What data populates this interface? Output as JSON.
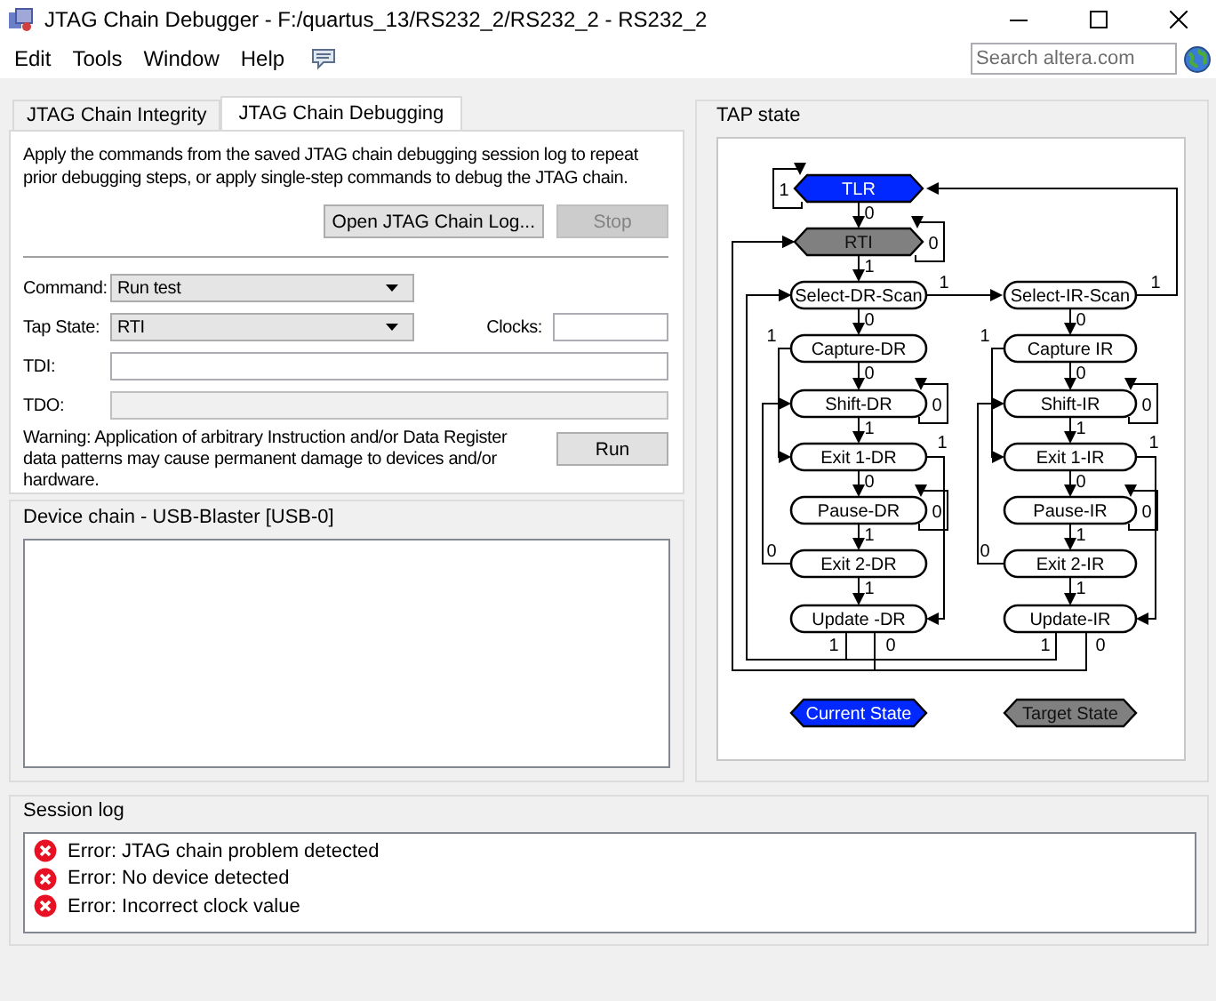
{
  "window": {
    "title": "JTAG Chain Debugger - F:/quartus_13/RS232_2/RS232_2 - RS232_2"
  },
  "menu": [
    "Edit",
    "Tools",
    "Window",
    "Help"
  ],
  "search": {
    "placeholder": "Search altera.com"
  },
  "tabs": [
    {
      "label": "JTAG Chain Integrity",
      "selected": false
    },
    {
      "label": "JTAG Chain Debugging",
      "selected": true
    }
  ],
  "debugging": {
    "description": "Apply the commands from the saved JTAG chain debugging session log to repeat prior debugging steps, or apply single-step commands to debug the JTAG chain.",
    "buttons": [
      {
        "label": "Open JTAG Chain Log...",
        "disabled": false
      },
      {
        "label": "Stop",
        "disabled": true
      }
    ],
    "command": {
      "label": "Command:",
      "value": "Run test"
    },
    "tap_state": {
      "label": "Tap State:",
      "value": "RTI"
    },
    "clocks": {
      "label": "Clocks:"
    },
    "tdi": {
      "label": "TDI:",
      "disabled": false
    },
    "tdo": {
      "label": "TDO:",
      "disabled": true
    },
    "warning": "Warning: Application of arbitrary Instruction and/or Data Register data patterns may cause permanent damage to devices and/or hardware.",
    "run_button": "Run"
  },
  "device_chain": {
    "title": "Device chain - USB-Blaster [USB-0]"
  },
  "tap_state": {
    "title": "TAP state",
    "nodes": [
      {
        "label": "TLR",
        "current": true,
        "target": false
      },
      {
        "label": "RTI",
        "current": false,
        "target": true
      },
      {
        "label": "Select-DR-Scan",
        "current": false,
        "target": false
      },
      {
        "label": "Capture-DR",
        "current": false,
        "target": false
      },
      {
        "label": "Shift-DR",
        "current": false,
        "target": false
      },
      {
        "label": "Exit 1-DR",
        "current": false,
        "target": false
      },
      {
        "label": "Pause-DR",
        "current": false,
        "target": false
      },
      {
        "label": "Exit 2-DR",
        "current": false,
        "target": false
      },
      {
        "label": "Update -DR",
        "current": false,
        "target": false
      },
      {
        "label": "Select-IR-Scan",
        "current": false,
        "target": false
      },
      {
        "label": "Capture IR",
        "current": false,
        "target": false
      },
      {
        "label": "Shift-IR",
        "current": false,
        "target": false
      },
      {
        "label": "Exit 1-IR",
        "current": false,
        "target": false
      },
      {
        "label": "Pause-IR",
        "current": false,
        "target": false
      },
      {
        "label": "Exit 2-IR",
        "current": false,
        "target": false
      },
      {
        "label": "Update-IR",
        "current": false,
        "target": false
      }
    ],
    "transitions": [
      {
        "label": "0"
      },
      {
        "label": "1"
      },
      {
        "label": "0"
      },
      {
        "label": "1"
      },
      {
        "label": "1"
      },
      {
        "label": "1"
      },
      {
        "label": "0"
      },
      {
        "label": "1"
      },
      {
        "label": "0"
      },
      {
        "label": "0"
      },
      {
        "label": "1"
      },
      {
        "label": "1"
      },
      {
        "label": "0"
      },
      {
        "label": "0"
      },
      {
        "label": "1"
      },
      {
        "label": "0"
      },
      {
        "label": "1"
      },
      {
        "label": "1"
      },
      {
        "label": "0"
      },
      {
        "label": "0"
      },
      {
        "label": "1"
      },
      {
        "label": "0"
      },
      {
        "label": "0"
      },
      {
        "label": "1"
      },
      {
        "label": "1"
      },
      {
        "label": "0"
      },
      {
        "label": "0"
      },
      {
        "label": "1"
      },
      {
        "label": "0"
      },
      {
        "label": "1"
      },
      {
        "label": "1"
      },
      {
        "label": "0"
      }
    ],
    "legend": [
      {
        "label": "Current State",
        "kind": "current"
      },
      {
        "label": "Target State",
        "kind": "target"
      }
    ]
  },
  "session_log": {
    "title": "Session log",
    "entries": [
      {
        "kind": "error",
        "text": "Error: JTAG chain problem detected"
      },
      {
        "kind": "error",
        "text": "Error: No device detected"
      },
      {
        "kind": "error",
        "text": "Error: Incorrect clock value"
      }
    ]
  }
}
